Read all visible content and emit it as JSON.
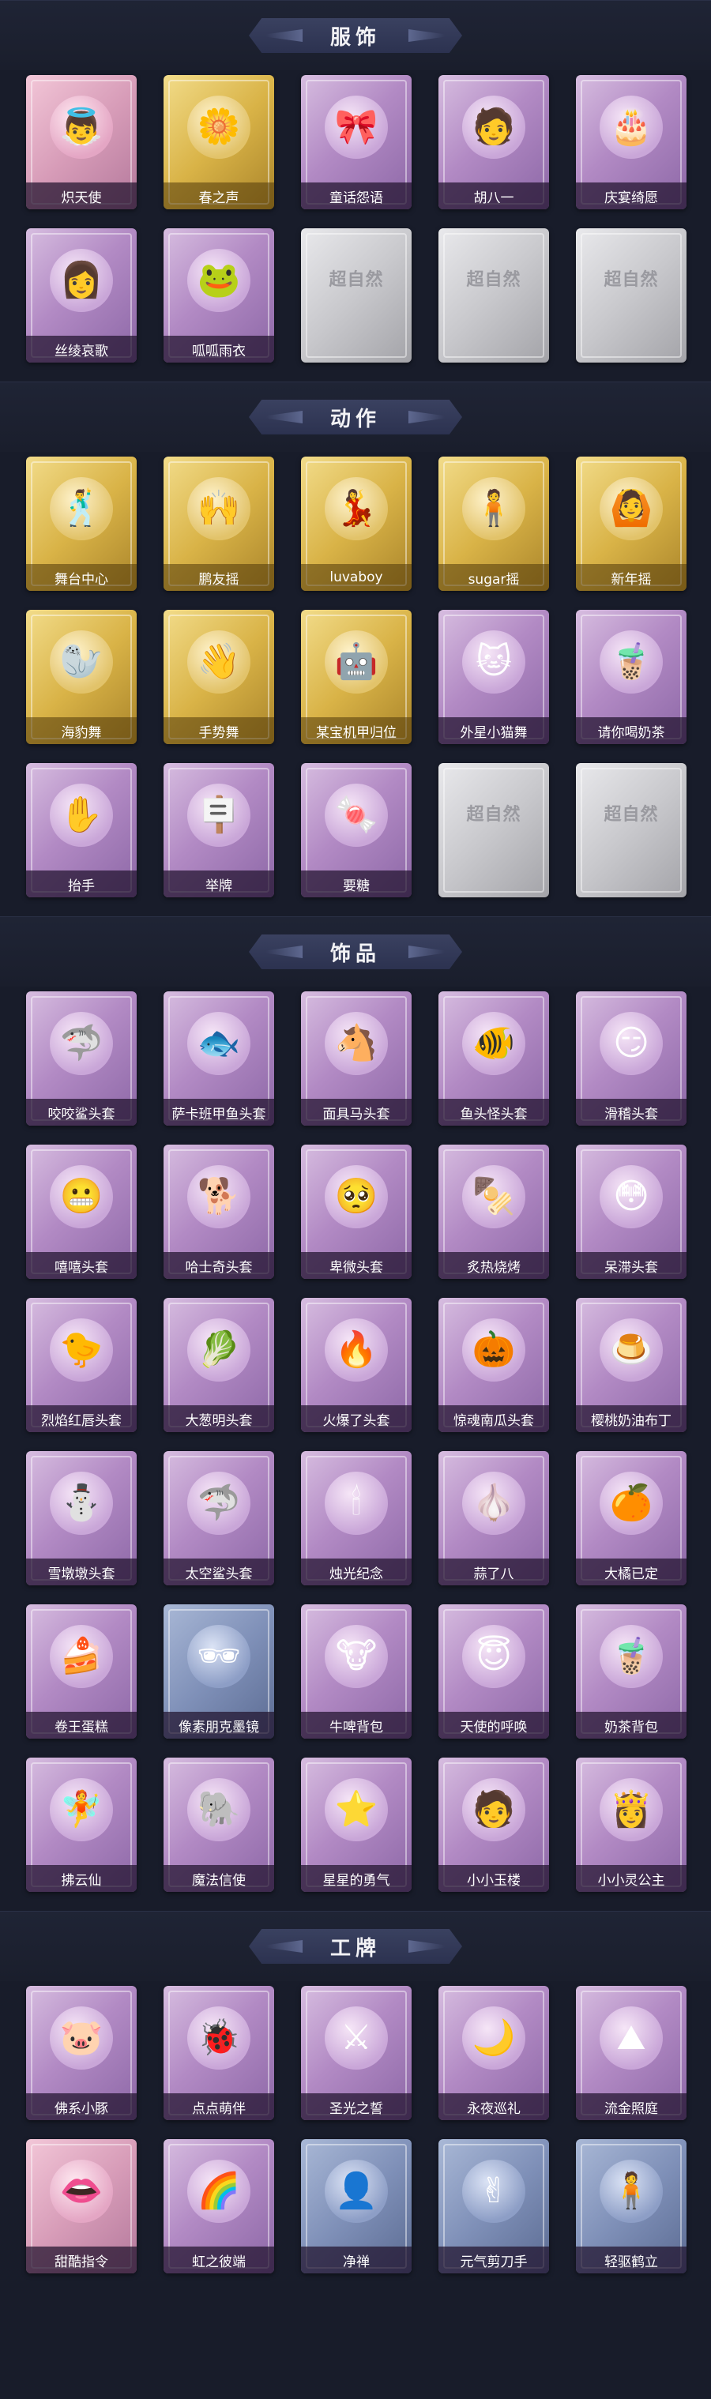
{
  "sections": [
    {
      "title": "服饰",
      "items": [
        {
          "label": "炽天使",
          "style": "pink",
          "icon": "👼"
        },
        {
          "label": "春之声",
          "style": "gold",
          "icon": "🌼"
        },
        {
          "label": "童话怨语",
          "style": "purple",
          "icon": "🎀"
        },
        {
          "label": "胡八一",
          "style": "purple",
          "icon": "🧑"
        },
        {
          "label": "庆宴绮愿",
          "style": "purple",
          "icon": "🎂"
        },
        {
          "label": "丝绫哀歌",
          "style": "purple",
          "icon": "👩"
        },
        {
          "label": "呱呱雨衣",
          "style": "purple",
          "icon": "🐸"
        },
        {
          "label": "",
          "style": "grey",
          "icon": "超自然"
        },
        {
          "label": "",
          "style": "grey",
          "icon": "超自然"
        },
        {
          "label": "",
          "style": "grey",
          "icon": "超自然"
        }
      ]
    },
    {
      "title": "动作",
      "items": [
        {
          "label": "舞台中心",
          "style": "gold",
          "icon": "🕺"
        },
        {
          "label": "鹏友摇",
          "style": "gold",
          "icon": "🙌"
        },
        {
          "label": "luvaboy",
          "style": "gold",
          "icon": "💃"
        },
        {
          "label": "sugar摇",
          "style": "gold",
          "icon": "🧍"
        },
        {
          "label": "新年摇",
          "style": "gold",
          "icon": "🙆"
        },
        {
          "label": "海豹舞",
          "style": "gold",
          "icon": "🦭"
        },
        {
          "label": "手势舞",
          "style": "gold",
          "icon": "👋"
        },
        {
          "label": "某宝机甲归位",
          "style": "gold",
          "icon": "🤖"
        },
        {
          "label": "外星小猫舞",
          "style": "purple",
          "icon": "🐱"
        },
        {
          "label": "请你喝奶茶",
          "style": "purple",
          "icon": "🧋"
        },
        {
          "label": "抬手",
          "style": "purple",
          "icon": "✋"
        },
        {
          "label": "举牌",
          "style": "purple",
          "icon": "🪧"
        },
        {
          "label": "要糖",
          "style": "purple",
          "icon": "🍬"
        },
        {
          "label": "",
          "style": "grey",
          "icon": "超自然"
        },
        {
          "label": "",
          "style": "grey",
          "icon": "超自然"
        }
      ]
    },
    {
      "title": "饰品",
      "items": [
        {
          "label": "咬咬鲨头套",
          "style": "purple",
          "icon": "🦈"
        },
        {
          "label": "萨卡班甲鱼头套",
          "style": "purple",
          "icon": "🐟"
        },
        {
          "label": "面具马头套",
          "style": "purple",
          "icon": "🐴"
        },
        {
          "label": "鱼头怪头套",
          "style": "purple",
          "icon": "🐠"
        },
        {
          "label": "滑稽头套",
          "style": "purple",
          "icon": "😏"
        },
        {
          "label": "嘻嘻头套",
          "style": "purple",
          "icon": "😬"
        },
        {
          "label": "哈士奇头套",
          "style": "purple",
          "icon": "🐕"
        },
        {
          "label": "卑微头套",
          "style": "purple",
          "icon": "🥺"
        },
        {
          "label": "炙热烧烤",
          "style": "purple",
          "icon": "🍢"
        },
        {
          "label": "呆滞头套",
          "style": "purple",
          "icon": "😳"
        },
        {
          "label": "烈焰红唇头套",
          "style": "purple",
          "icon": "🐤"
        },
        {
          "label": "大葱明头套",
          "style": "purple",
          "icon": "🥬"
        },
        {
          "label": "火爆了头套",
          "style": "purple",
          "icon": "🔥"
        },
        {
          "label": "惊魂南瓜头套",
          "style": "purple",
          "icon": "🎃"
        },
        {
          "label": "樱桃奶油布丁",
          "style": "purple",
          "icon": "🍮"
        },
        {
          "label": "雪墩墩头套",
          "style": "purple",
          "icon": "⛄"
        },
        {
          "label": "太空鲨头套",
          "style": "purple",
          "icon": "🦈"
        },
        {
          "label": "烛光纪念",
          "style": "purple",
          "icon": "🕯"
        },
        {
          "label": "蒜了八",
          "style": "purple",
          "icon": "🧄"
        },
        {
          "label": "大橘已定",
          "style": "purple",
          "icon": "🍊"
        },
        {
          "label": "卷王蛋糕",
          "style": "purple",
          "icon": "🍰"
        },
        {
          "label": "像素朋克墨镜",
          "style": "blue",
          "icon": "🕶"
        },
        {
          "label": "牛啤背包",
          "style": "purple",
          "icon": "🐮"
        },
        {
          "label": "天使的呼唤",
          "style": "purple",
          "icon": "😇"
        },
        {
          "label": "奶茶背包",
          "style": "purple",
          "icon": "🧋"
        },
        {
          "label": "拂云仙",
          "style": "purple",
          "icon": "🧚"
        },
        {
          "label": "魔法信使",
          "style": "purple",
          "icon": "🐘"
        },
        {
          "label": "星星的勇气",
          "style": "purple",
          "icon": "⭐"
        },
        {
          "label": "小小玉楼",
          "style": "purple",
          "icon": "🧑"
        },
        {
          "label": "小小灵公主",
          "style": "purple",
          "icon": "👸"
        }
      ]
    },
    {
      "title": "工牌",
      "items": [
        {
          "label": "佛系小豚",
          "style": "purple",
          "icon": "🐷"
        },
        {
          "label": "点点萌伴",
          "style": "purple",
          "icon": "🐞"
        },
        {
          "label": "圣光之誓",
          "style": "purple",
          "icon": "⚔"
        },
        {
          "label": "永夜巡礼",
          "style": "purple",
          "icon": "🌙"
        },
        {
          "label": "流金照庭",
          "style": "purple",
          "icon": "⛰"
        },
        {
          "label": "甜酷指令",
          "style": "pink",
          "icon": "👄"
        },
        {
          "label": "虹之彼端",
          "style": "purple",
          "icon": "🌈"
        },
        {
          "label": "净禅",
          "style": "blue",
          "icon": "👤"
        },
        {
          "label": "元气剪刀手",
          "style": "blue",
          "icon": "✌"
        },
        {
          "label": "轻驱鹤立",
          "style": "blue",
          "icon": "🧍"
        }
      ]
    }
  ]
}
